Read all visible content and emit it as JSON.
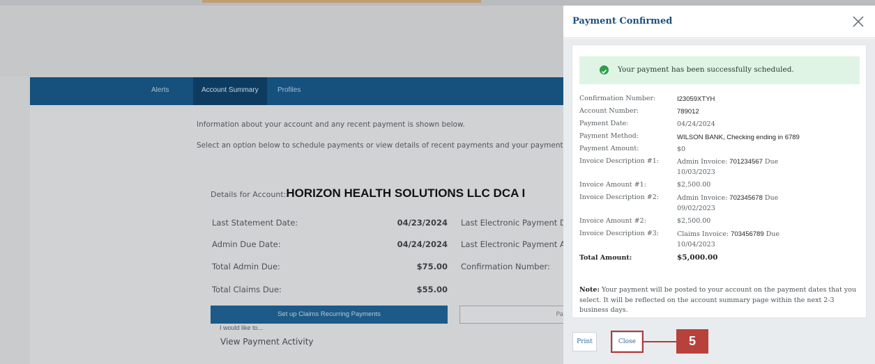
{
  "nav": {
    "items": [
      "Alerts",
      "Account Summary",
      "Profiles"
    ],
    "active": "Account Summary"
  },
  "page": {
    "info_line_1": "Information about your account and any recent payment is shown below.",
    "info_line_2": "Select an option below to schedule payments or view details of recent payments and your payment r",
    "details_label": "Details for Account:",
    "details_name": "HORIZON HEALTH SOLUTIONS LLC DCA I",
    "rows": [
      {
        "label": "Last Statement Date:",
        "value": "04/23/2024",
        "right_label": "Last Electronic Payment Dat"
      },
      {
        "label": "Admin Due Date:",
        "value": "04/24/2024",
        "right_label": "Last Electronic Payment Am"
      },
      {
        "label": "Total Admin Due:",
        "value": "$75.00",
        "right_label": "Confirmation Number:"
      },
      {
        "label": "Total Claims Due:",
        "value": "$55.00",
        "right_label": ""
      }
    ],
    "claims_button": "Set up Claims Recurring Payments",
    "pay_button_partial": "Pa",
    "would_like": "I would like to...",
    "view_activity": "View Payment Activity"
  },
  "modal": {
    "title": "Payment Confirmed",
    "success_message": "Your payment has been successfully scheduled.",
    "details": [
      {
        "label": "Confirmation Number:",
        "value": "I23059XTYH"
      },
      {
        "label": "Account Number:",
        "value": "789012"
      },
      {
        "label": "Payment Date:",
        "value": "04/24/2024"
      },
      {
        "label": "Payment Method:",
        "value": "WILSON BANK, Checking ending in 6789"
      },
      {
        "label": "Payment Amount:",
        "value": "$0"
      },
      {
        "label": "Invoice Description #1:",
        "value_prefix": "Admin Invoice: ",
        "invoice": "701234567",
        "value_suffix": "  Due",
        "value_line2": "10/03/2023"
      },
      {
        "label": "Invoice Amount #1:",
        "value": "$2,500.00"
      },
      {
        "label": "Invoice Description #2:",
        "value_prefix": "Admin Invoice: ",
        "invoice": "702345678",
        "value_suffix": "  Due",
        "value_line2": "09/02/2023"
      },
      {
        "label": "Invoice Amount #2:",
        "value": "$2,500.00"
      },
      {
        "label": "Invoice Description #3:",
        "value_prefix": "Claims Invoice: ",
        "invoice": "703456789",
        "value_suffix": "  Due",
        "value_line2": "10/04/2023"
      },
      {
        "label": "Total Amount:",
        "value": "$5,000.00"
      }
    ],
    "note_bold": "Note:",
    "note_text": " Your payment will be posted to your account on the payment dates that you select. It will be reflected on the account summary page within the next 2-3 business days.",
    "print_button": "Print",
    "close_button": "Close"
  },
  "callout": {
    "number": "5",
    "color": "#b8413c"
  },
  "colors": {
    "nav": "#16507d",
    "title": "#1b4f80",
    "success_bg": "#dff4e4",
    "success_icon": "#2e9e4a"
  }
}
